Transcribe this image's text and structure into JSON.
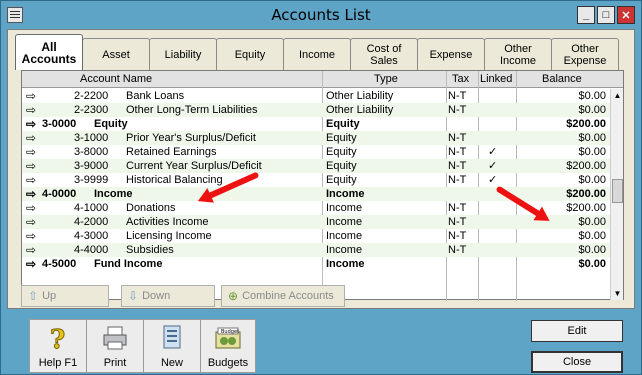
{
  "window": {
    "title": "Accounts List"
  },
  "tabs": [
    {
      "label": "All Accounts",
      "active": true
    },
    {
      "label": "Asset"
    },
    {
      "label": "Liability"
    },
    {
      "label": "Equity"
    },
    {
      "label": "Income"
    },
    {
      "label": "Cost of Sales"
    },
    {
      "label": "Expense"
    },
    {
      "label": "Other Income"
    },
    {
      "label": "Other Expense"
    }
  ],
  "table": {
    "headers": {
      "name": "Account Name",
      "type": "Type",
      "tax": "Tax",
      "linked": "Linked",
      "balance": "Balance"
    },
    "rows": [
      {
        "number": "2-2200",
        "name": "Bank Loans",
        "type": "Other Liability",
        "tax": "N-T",
        "linked": "",
        "balance": "$0.00",
        "level": 2
      },
      {
        "number": "2-2300",
        "name": "Other Long-Term Liabilities",
        "type": "Other Liability",
        "tax": "N-T",
        "linked": "",
        "balance": "$0.00",
        "level": 2
      },
      {
        "number": "3-0000",
        "name": "Equity",
        "type": "Equity",
        "tax": "",
        "linked": "",
        "balance": "$200.00",
        "level": 1
      },
      {
        "number": "3-1000",
        "name": "Prior Year's Surplus/Deficit",
        "type": "Equity",
        "tax": "N-T",
        "linked": "",
        "balance": "$0.00",
        "level": 2
      },
      {
        "number": "3-8000",
        "name": "Retained Earnings",
        "type": "Equity",
        "tax": "N-T",
        "linked": "✓",
        "balance": "$0.00",
        "level": 2
      },
      {
        "number": "3-9000",
        "name": "Current Year Surplus/Deficit",
        "type": "Equity",
        "tax": "N-T",
        "linked": "✓",
        "balance": "$200.00",
        "level": 2
      },
      {
        "number": "3-9999",
        "name": "Historical Balancing",
        "type": "Equity",
        "tax": "N-T",
        "linked": "✓",
        "balance": "$0.00",
        "level": 2
      },
      {
        "number": "4-0000",
        "name": "Income",
        "type": "Income",
        "tax": "",
        "linked": "",
        "balance": "$200.00",
        "level": 1
      },
      {
        "number": "4-1000",
        "name": "Donations",
        "type": "Income",
        "tax": "N-T",
        "linked": "",
        "balance": "$200.00",
        "level": 2
      },
      {
        "number": "4-2000",
        "name": "Activities Income",
        "type": "Income",
        "tax": "N-T",
        "linked": "",
        "balance": "$0.00",
        "level": 2
      },
      {
        "number": "4-3000",
        "name": "Licensing Income",
        "type": "Income",
        "tax": "N-T",
        "linked": "",
        "balance": "$0.00",
        "level": 2
      },
      {
        "number": "4-4000",
        "name": "Subsidies",
        "type": "Income",
        "tax": "N-T",
        "linked": "",
        "balance": "$0.00",
        "level": 2
      },
      {
        "number": "4-5000",
        "name": "Fund Income",
        "type": "Income",
        "tax": "",
        "linked": "",
        "balance": "$0.00",
        "level": 1
      }
    ]
  },
  "panel_buttons": {
    "up": "Up",
    "down": "Down",
    "combine": "Combine Accounts"
  },
  "toolbar": {
    "help": "Help F1",
    "print": "Print",
    "new": "New",
    "budgets": "Budgets",
    "budget_sign": "Budget"
  },
  "side_buttons": {
    "edit": "Edit",
    "close": "Close"
  },
  "colors": {
    "title_bar": "#5ea4c7",
    "panel": "#ece9d8",
    "row_alt": "#eef7ea",
    "annotation_arrow": "#e11111"
  }
}
